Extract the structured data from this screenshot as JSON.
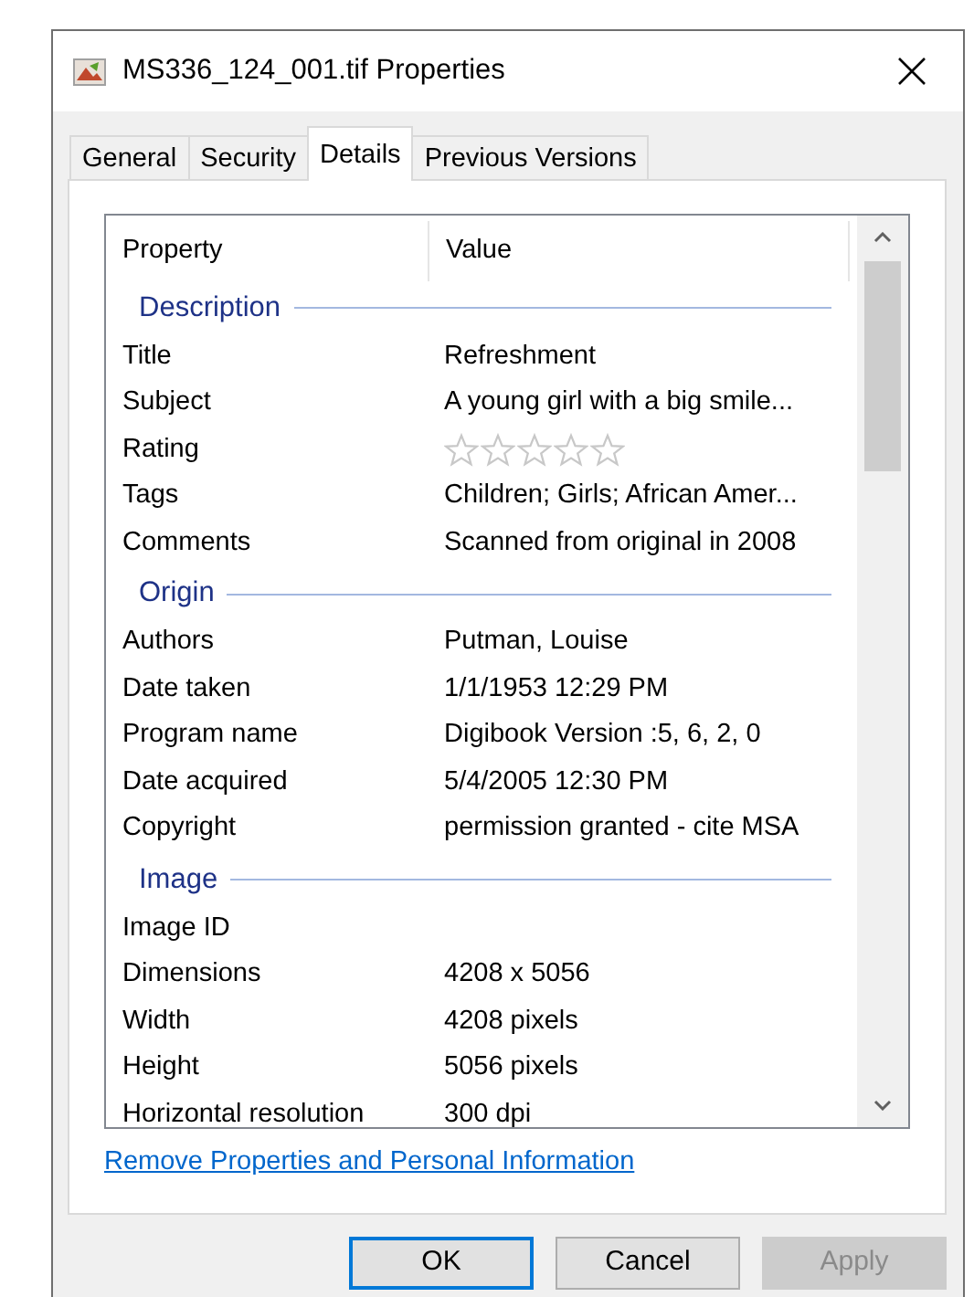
{
  "window": {
    "title": "MS336_124_001.tif Properties"
  },
  "tabs": [
    {
      "label": "General",
      "selected": false
    },
    {
      "label": "Security",
      "selected": false
    },
    {
      "label": "Details",
      "selected": true
    },
    {
      "label": "Previous Versions",
      "selected": false
    }
  ],
  "list": {
    "columns": [
      "Property",
      "Value"
    ],
    "groups": [
      {
        "header": "Description",
        "rows": [
          {
            "kind": "text",
            "property": "Title",
            "value": "Refreshment"
          },
          {
            "kind": "text",
            "property": "Subject",
            "value": "A young girl with a big smile..."
          },
          {
            "kind": "rating",
            "property": "Rating",
            "stars": 0
          },
          {
            "kind": "text",
            "property": "Tags",
            "value": "Children; Girls; African Amer..."
          },
          {
            "kind": "text",
            "property": "Comments",
            "value": "Scanned from original in 2008"
          }
        ]
      },
      {
        "header": "Origin",
        "rows": [
          {
            "kind": "text",
            "property": "Authors",
            "value": "Putman, Louise"
          },
          {
            "kind": "text",
            "property": "Date taken",
            "value": "1/1/1953 12:29 PM"
          },
          {
            "kind": "text",
            "property": "Program name",
            "value": "Digibook Version :5, 6, 2, 0"
          },
          {
            "kind": "text",
            "property": "Date acquired",
            "value": "5/4/2005 12:30 PM"
          },
          {
            "kind": "text",
            "property": "Copyright",
            "value": "permission granted - cite MSA"
          }
        ]
      },
      {
        "header": "Image",
        "rows": [
          {
            "kind": "text",
            "property": "Image ID"
          },
          {
            "kind": "text",
            "property": "Dimensions",
            "value": "4208 x 5056"
          },
          {
            "kind": "text",
            "property": "Width",
            "value": "4208 pixels"
          },
          {
            "kind": "text",
            "property": "Height",
            "value": "5056 pixels"
          },
          {
            "kind": "text",
            "property": "Horizontal resolution",
            "value": "300 dpi"
          }
        ]
      }
    ]
  },
  "link": "Remove Properties and Personal Information",
  "buttons": [
    {
      "label": "OK",
      "default": true,
      "disabled": false
    },
    {
      "label": "Cancel",
      "default": false,
      "disabled": false
    },
    {
      "label": "Apply",
      "default": false,
      "disabled": true
    }
  ]
}
